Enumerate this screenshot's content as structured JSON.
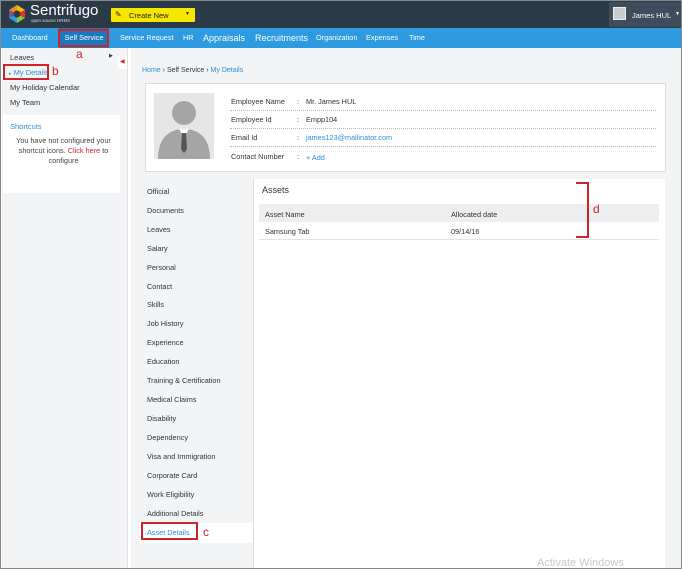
{
  "app": {
    "brand": "Sentrifugo",
    "brand_sub": "open source HRMS",
    "create_new": "Create New",
    "user_name": "James HUL"
  },
  "nav": {
    "items": [
      {
        "label": "Dashboard"
      },
      {
        "label": "Self Service"
      },
      {
        "label": "Service Request"
      },
      {
        "label": "HR"
      },
      {
        "label": "Appraisals"
      },
      {
        "label": "Recruitments"
      },
      {
        "label": "Organization"
      },
      {
        "label": "Expenses"
      },
      {
        "label": "Time"
      }
    ]
  },
  "sidebar": {
    "items": [
      {
        "label": "Leaves"
      },
      {
        "label": "My Details"
      },
      {
        "label": "My Holiday Calendar"
      },
      {
        "label": "My Team"
      }
    ],
    "shortcuts": {
      "title": "Shortcuts",
      "msg_before": "You have not configured your shortcut icons.",
      "link": "Click here",
      "msg_after": "to configure"
    }
  },
  "breadcrumb": {
    "home": "Home",
    "section": "Self Service",
    "current": "My Details",
    "separator": "›"
  },
  "profile": {
    "fields": [
      {
        "label": "Employee Name",
        "value": "Mr. James HUL"
      },
      {
        "label": "Employee Id",
        "value": "Empp104"
      },
      {
        "label": "Email Id",
        "value": "james123@mailinator.com"
      },
      {
        "label": "Contact Number",
        "value": "+ Add"
      }
    ]
  },
  "tabs": [
    {
      "label": "Official"
    },
    {
      "label": "Documents"
    },
    {
      "label": "Leaves"
    },
    {
      "label": "Salary"
    },
    {
      "label": "Personal"
    },
    {
      "label": "Contact"
    },
    {
      "label": "Skills"
    },
    {
      "label": "Job History"
    },
    {
      "label": "Experience"
    },
    {
      "label": "Education"
    },
    {
      "label": "Training & Certification"
    },
    {
      "label": "Medical Claims"
    },
    {
      "label": "Disability"
    },
    {
      "label": "Dependency"
    },
    {
      "label": "Visa and Immigration"
    },
    {
      "label": "Corporate Card"
    },
    {
      "label": "Work Eligibility"
    },
    {
      "label": "Additional Details"
    },
    {
      "label": "Asset Details"
    }
  ],
  "assets": {
    "title": "Assets",
    "columns": [
      "Asset Name",
      "Allocated date"
    ],
    "rows": [
      [
        "Samsung Tab",
        "09/14/16"
      ]
    ]
  },
  "annotations": {
    "a": "a",
    "b": "b",
    "c": "c",
    "d": "d",
    "color": "#d0242a"
  },
  "watermark": "Activate Windows",
  "colors": {
    "topbar": "#2b3a47",
    "navbar": "#2e9ae0",
    "nav_active": "#1a78bd",
    "create_button": "#f6e600",
    "link": "#2e8fd4"
  },
  "icons": {
    "logo": "sentrifugo-logo-icon",
    "create": "pen-icon",
    "avatar": "user-avatar-icon"
  }
}
